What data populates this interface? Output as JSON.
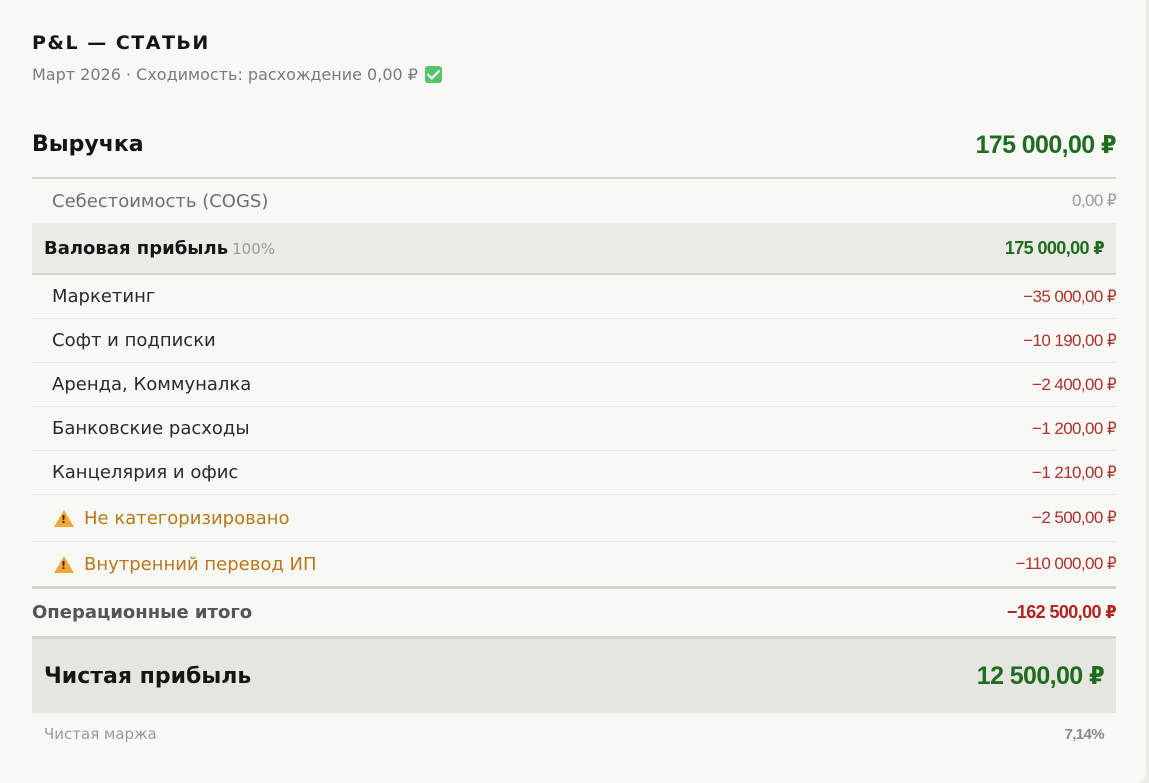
{
  "header": {
    "title": "P&L — СТАТЬИ",
    "subtitle": "Март 2026 · Сходимость: расхождение 0,00 ₽"
  },
  "revenue": {
    "label": "Выручка",
    "amount": "175 000,00 ₽"
  },
  "cogs": {
    "label": "Себестоимость (COGS)",
    "amount": "0,00 ₽"
  },
  "gross_profit": {
    "label": "Валовая прибыль",
    "percent": "100%",
    "amount": "175 000,00 ₽"
  },
  "expenses": [
    {
      "label": "Маркетинг",
      "amount": "−35 000,00 ₽"
    },
    {
      "label": "Софт и подписки",
      "amount": "−10 190,00 ₽"
    },
    {
      "label": "Аренда, Коммуналка",
      "amount": "−2 400,00 ₽"
    },
    {
      "label": "Банковские расходы",
      "amount": "−1 200,00 ₽"
    },
    {
      "label": "Канцелярия и офис",
      "amount": "−1 210,00 ₽"
    },
    {
      "label": "Не категоризировано",
      "amount": "−2 500,00 ₽",
      "icon": "warning-icon"
    },
    {
      "label": "Внутренний перевод ИП",
      "amount": "−110 000,00 ₽",
      "icon": "warning-icon"
    }
  ],
  "operating_total": {
    "label": "Операционные итого",
    "amount": "−162 500,00 ₽"
  },
  "net_profit": {
    "label": "Чистая прибыль",
    "amount": "12 500,00 ₽"
  },
  "net_margin": {
    "label": "Чистая маржа",
    "value": "7,14%"
  },
  "colors": {
    "positive": "#1f6b1f",
    "negative": "#b03030",
    "warning": "#b8781c",
    "check": "#58c36d"
  }
}
